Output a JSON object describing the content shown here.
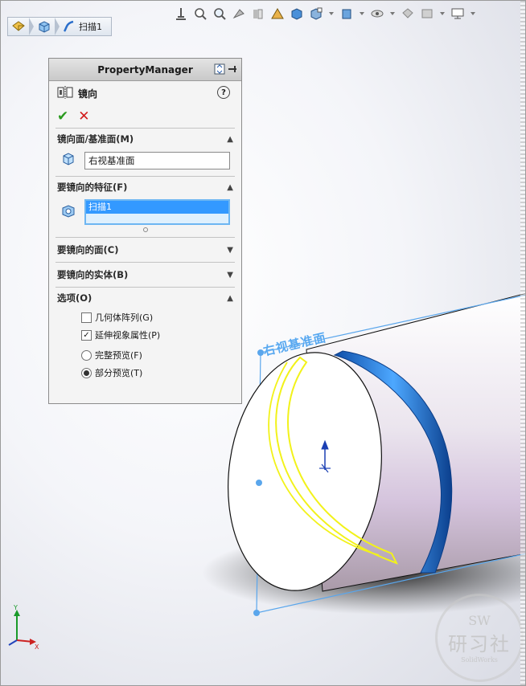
{
  "breadcrumb": {
    "feature_label": "扫描1"
  },
  "property_manager": {
    "header_title": "PropertyManager",
    "feature_title": "镜向",
    "help_label": "?",
    "ok_label": "✔",
    "cancel_label": "✕",
    "groups": {
      "mirror_plane": {
        "title": "镜向面/基准面(M)",
        "value": "右视基准面"
      },
      "features_to_mirror": {
        "title": "要镜向的特征(F)",
        "selected_item": "扫描1"
      },
      "faces_to_mirror": {
        "title": "要镜向的面(C)"
      },
      "bodies_to_mirror": {
        "title": "要镜向的实体(B)"
      },
      "options": {
        "title": "选项(O)",
        "geometry_pattern": {
          "label": "几何体阵列(G)",
          "checked": false
        },
        "propagate_visual": {
          "label": "延伸视象属性(P)",
          "checked": true
        },
        "full_preview": {
          "label": "完整预览(F)",
          "selected": false
        },
        "partial_preview": {
          "label": "部分预览(T)",
          "selected": true
        }
      }
    }
  },
  "viewport": {
    "plane_label": "右视基准面"
  },
  "axis": {
    "y_label": "Y",
    "x_label": "X"
  },
  "watermark": {
    "top": "SW",
    "main": "研习社",
    "sub": "SolidWorks"
  },
  "colors": {
    "accent_blue": "#3399ff",
    "plane_blue": "#58a8f0",
    "sketch_yellow": "#f2f21a",
    "sweep_blue": "#1f74d6",
    "ok_green": "#2a9a1e",
    "cancel_red": "#d11b1b"
  }
}
